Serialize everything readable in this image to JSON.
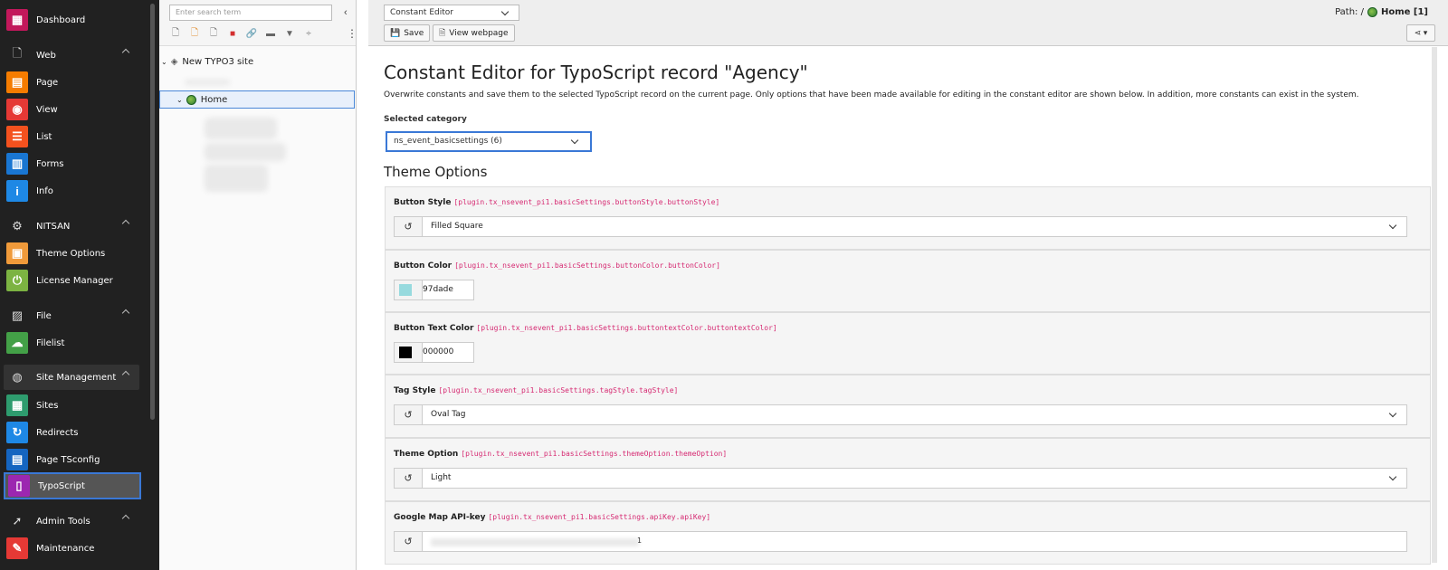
{
  "modules": [
    {
      "label": "Dashboard",
      "icon": "dashboard-icon",
      "color": "#c2185b",
      "type": "item"
    },
    {
      "label": "Web",
      "icon": "page-icon",
      "type": "group"
    },
    {
      "label": "Page",
      "icon": "page-module-icon",
      "color": "#f57c00",
      "type": "item"
    },
    {
      "label": "View",
      "icon": "eye-icon",
      "color": "#e53935",
      "type": "item"
    },
    {
      "label": "List",
      "icon": "list-icon",
      "color": "#f4511e",
      "type": "item"
    },
    {
      "label": "Forms",
      "icon": "forms-icon",
      "color": "#1976d2",
      "type": "item"
    },
    {
      "label": "Info",
      "icon": "info-icon",
      "color": "#1e88e5",
      "type": "item"
    },
    {
      "label": "NITSAN",
      "icon": "gear-icon",
      "type": "group"
    },
    {
      "label": "Theme Options",
      "icon": "box-icon",
      "color": "#f09a3a",
      "type": "item"
    },
    {
      "label": "License Manager",
      "icon": "power-icon",
      "color": "#7cb342",
      "type": "item"
    },
    {
      "label": "File",
      "icon": "image-icon",
      "type": "group"
    },
    {
      "label": "Filelist",
      "icon": "cloud-icon",
      "color": "#43a047",
      "type": "item"
    },
    {
      "label": "Site Management",
      "icon": "globe-icon",
      "type": "group"
    },
    {
      "label": "Sites",
      "icon": "sites-icon",
      "color": "#2e9c6e",
      "type": "item"
    },
    {
      "label": "Redirects",
      "icon": "redirect-icon",
      "color": "#1e88e5",
      "type": "item"
    },
    {
      "label": "Page TSconfig",
      "icon": "tsconfig-icon",
      "color": "#1565c0",
      "type": "item"
    },
    {
      "label": "TypoScript",
      "icon": "typoscript-icon",
      "color": "#9c27b0",
      "type": "item"
    },
    {
      "label": "Admin Tools",
      "icon": "rocket-icon",
      "type": "group"
    },
    {
      "label": "Maintenance",
      "icon": "wrench-icon",
      "color": "#e53935",
      "type": "item"
    }
  ],
  "tree": {
    "search_placeholder": "Enter search term",
    "root": "New TYPO3 site",
    "home": "Home"
  },
  "header": {
    "module_select": "Constant Editor",
    "save": "Save",
    "view": "View webpage",
    "path_label": "Path: /",
    "path_page": "Home [1]"
  },
  "content": {
    "title": "Constant Editor for TypoScript record \"Agency\"",
    "description": "Overwrite constants and save them to the selected TypoScript record on the current page. Only options that have been made available for editing in the constant editor are shown below. In addition, more constants can exist in the system.",
    "category_label": "Selected category",
    "category_value": "ns_event_basicsettings (6)",
    "section": "Theme Options"
  },
  "fields": {
    "button_style": {
      "label": "Button Style",
      "key": "[plugin.tx_nsevent_pi1.basicSettings.buttonStyle.buttonStyle]",
      "value": "Filled Square"
    },
    "button_color": {
      "label": "Button Color",
      "key": "[plugin.tx_nsevent_pi1.basicSettings.buttonColor.buttonColor]",
      "value": "97dade",
      "swatch": "#97dade"
    },
    "button_text_color": {
      "label": "Button Text Color",
      "key": "[plugin.tx_nsevent_pi1.basicSettings.buttontextColor.buttontextColor]",
      "value": "000000",
      "swatch": "#000000"
    },
    "tag_style": {
      "label": "Tag Style",
      "key": "[plugin.tx_nsevent_pi1.basicSettings.tagStyle.tagStyle]",
      "value": "Oval Tag"
    },
    "theme_option": {
      "label": "Theme Option",
      "key": "[plugin.tx_nsevent_pi1.basicSettings.themeOption.themeOption]",
      "value": "Light"
    },
    "api_key": {
      "label": "Google Map API-key",
      "key": "[plugin.tx_nsevent_pi1.basicSettings.apiKey.apiKey]",
      "value_end": "1"
    }
  }
}
